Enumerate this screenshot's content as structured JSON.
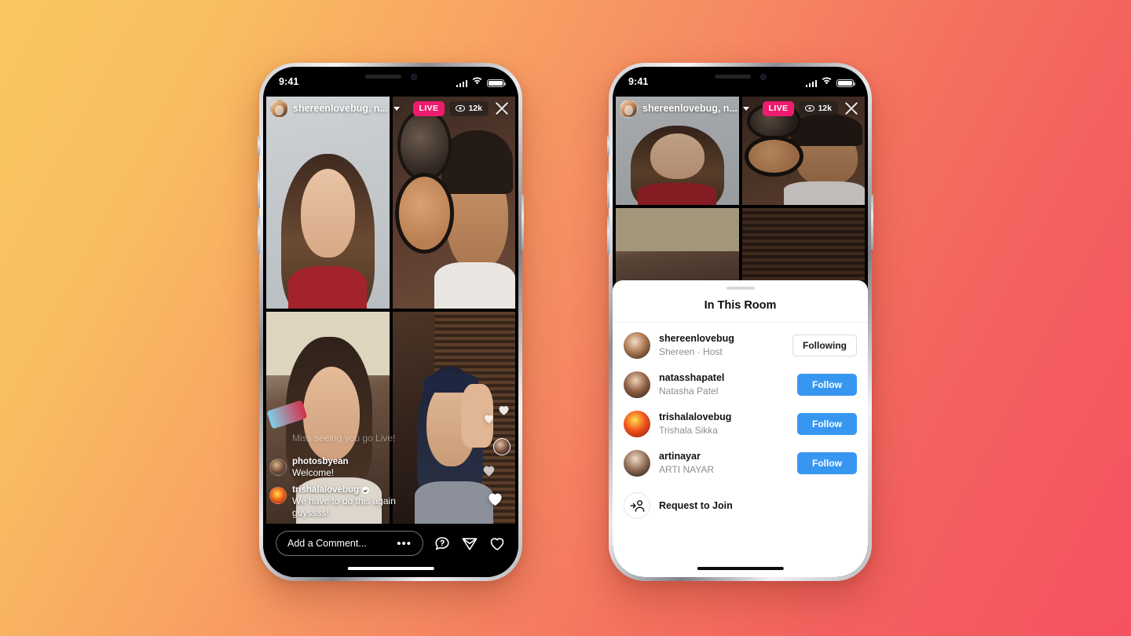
{
  "background": {
    "gradient_from": "#F9C75F",
    "gradient_to": "#F4525F"
  },
  "status_bar": {
    "time": "9:41",
    "signal_icon": "cellular-signal-icon",
    "wifi_icon": "wifi-icon",
    "battery_icon": "battery-icon"
  },
  "live_header": {
    "host_avatar": "host-avatar",
    "title": "shereenlovebug, n...",
    "chevron_icon": "chevron-down-icon",
    "live_label": "LIVE",
    "viewer_icon": "eye-icon",
    "viewer_count": "12k",
    "close_icon": "close-icon",
    "live_color": "#ED1C6F"
  },
  "tiles": [
    {
      "name": "tile-shereen"
    },
    {
      "name": "tile-makeup"
    },
    {
      "name": "tile-mascara"
    },
    {
      "name": "tile-shutters"
    }
  ],
  "comments": [
    {
      "user": "",
      "text": "Miss seeing you go Live!",
      "verified": false,
      "faded": true
    },
    {
      "user": "photosbyean",
      "text": "Welcome!",
      "verified": false,
      "faded": false
    },
    {
      "user": "trishalalovebug",
      "text": "We have to do this again guyssss!",
      "verified": true,
      "faded": false
    }
  ],
  "bottom_bar": {
    "comment_placeholder": "Add a Comment...",
    "more_icon": "more-dots-icon",
    "question_icon": "question-bubble-icon",
    "send_icon": "send-icon",
    "like_icon": "heart-icon"
  },
  "reactions": {
    "heart_icon": "heart-reaction-icon",
    "avatar_icon": "reaction-avatar"
  },
  "sheet": {
    "grabber": "sheet-grabber",
    "title": "In This Room",
    "rows": [
      {
        "username": "shereenlovebug",
        "fullname": "Shereen · Host",
        "action": "Following",
        "action_style": "following",
        "avatar": "avatar-shereen"
      },
      {
        "username": "natasshapatel",
        "fullname": "Natasha Patel",
        "action": "Follow",
        "action_style": "follow",
        "avatar": "avatar-natassha"
      },
      {
        "username": "trishalalovebug",
        "fullname": "Trishala Sikka",
        "action": "Follow",
        "action_style": "follow",
        "avatar": "avatar-trishala"
      },
      {
        "username": "artinayar",
        "fullname": "ARTI NAYAR",
        "action": "Follow",
        "action_style": "follow",
        "avatar": "avatar-arti"
      }
    ],
    "request": {
      "icon": "request-to-join-icon",
      "label": "Request to Join"
    },
    "follow_color": "#3797F0"
  }
}
